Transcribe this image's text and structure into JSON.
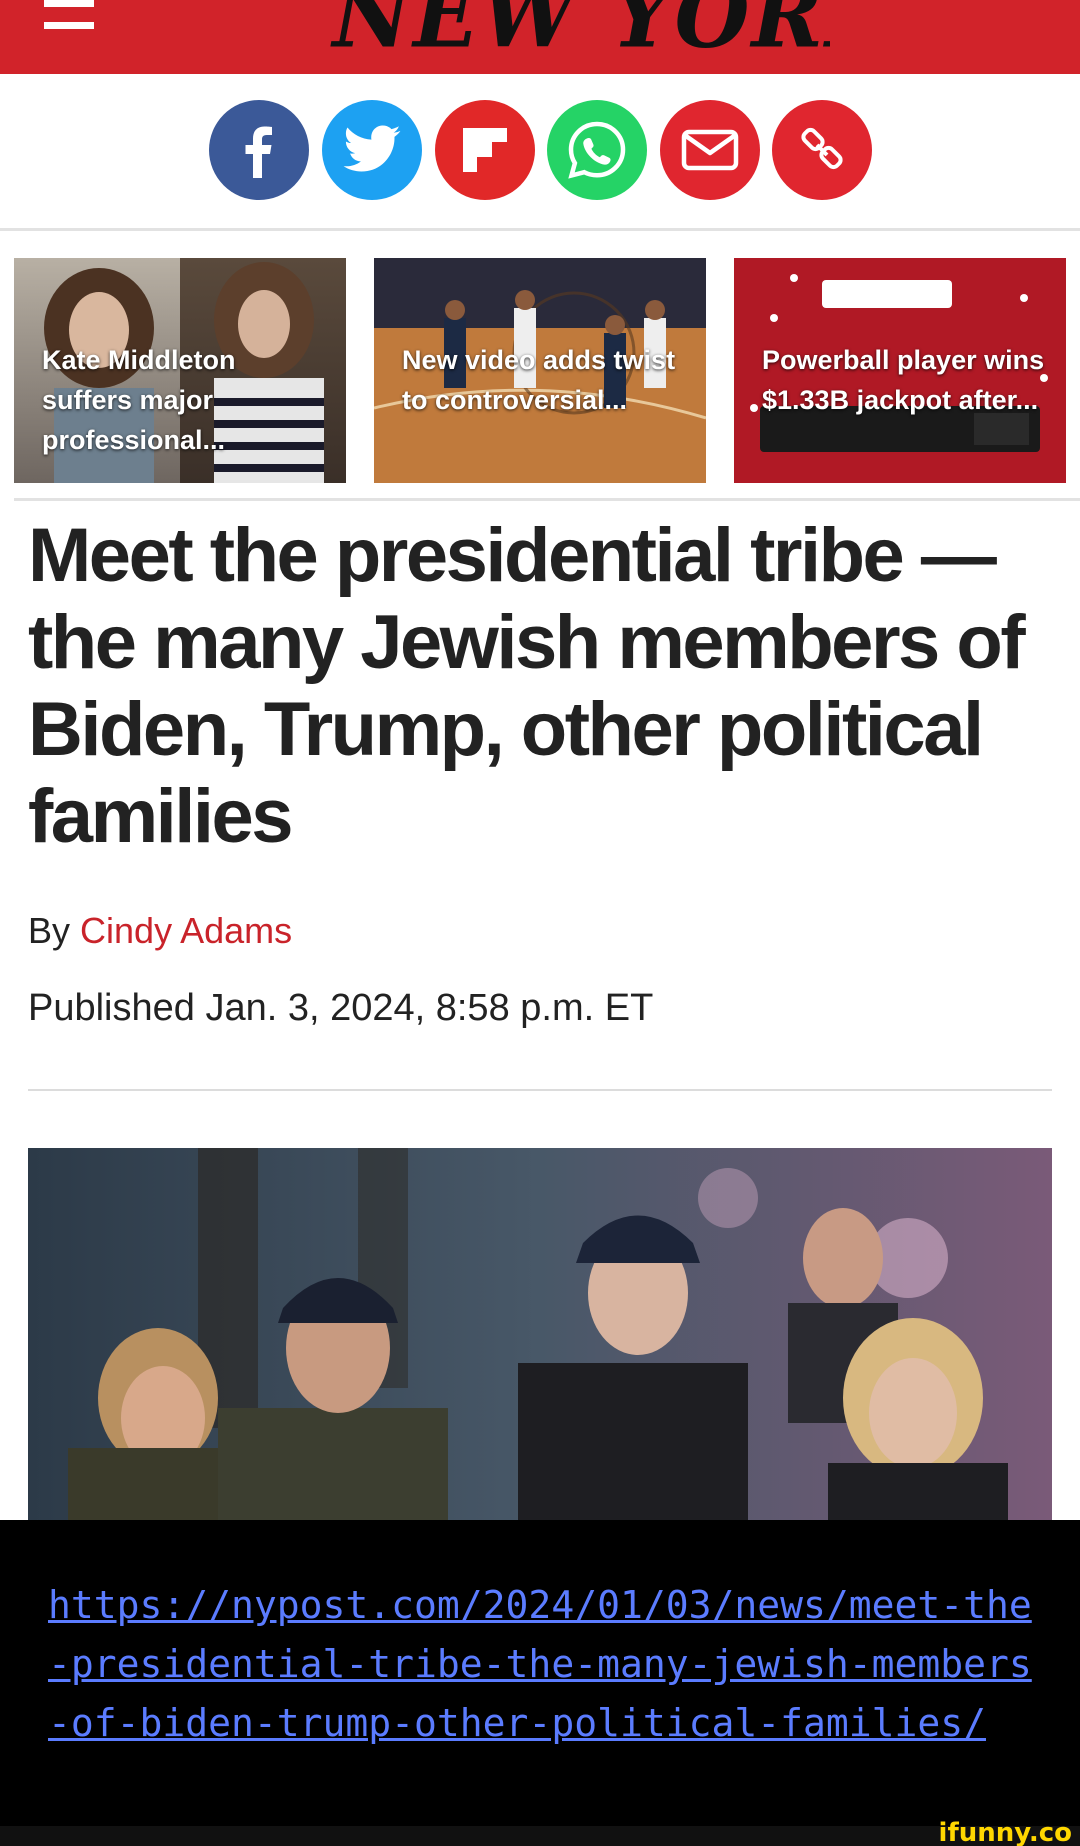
{
  "header": {
    "logo_text": "NEW YORK POST",
    "menu_icon": "hamburger-menu-icon",
    "brand_color": "#d1232a"
  },
  "share": {
    "buttons": [
      {
        "name": "facebook",
        "icon": "facebook-icon",
        "color": "#3b5998"
      },
      {
        "name": "twitter",
        "icon": "twitter-icon",
        "color": "#1da1f2"
      },
      {
        "name": "flipboard",
        "icon": "flipboard-icon",
        "color": "#e12828"
      },
      {
        "name": "whatsapp",
        "icon": "whatsapp-icon",
        "color": "#25d366"
      },
      {
        "name": "email",
        "icon": "email-icon",
        "color": "#e0262f"
      },
      {
        "name": "copy-link",
        "icon": "link-icon",
        "color": "#e0262f"
      }
    ]
  },
  "teasers": [
    {
      "title": "Kate Middleton suffers major professional..."
    },
    {
      "title": "New video adds twist to controversial..."
    },
    {
      "title": "Powerball player wins $1.33B jackpot after..."
    }
  ],
  "article": {
    "headline": "Meet the presidential tribe — the many Jewish members of Biden, Trump, other political families",
    "by_prefix": "By",
    "author": "Cindy Adams",
    "published": "Published Jan. 3, 2024, 8:58 p.m. ET"
  },
  "overlay": {
    "url": "https://nypost.com/2024/01/03/news/meet-the-presidential-tribe-the-many-jewish-members-of-biden-trump-other-political-families/",
    "watermark": "ifunny.co"
  }
}
